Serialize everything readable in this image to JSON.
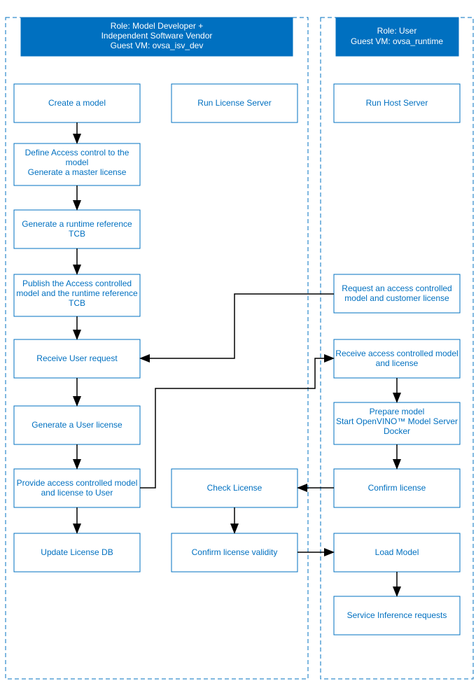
{
  "lanes": {
    "left": {
      "title1": "Role: Model Developer +",
      "title2": "Independent Software Vendor",
      "title3": "Guest VM: ovsa_isv_dev"
    },
    "right": {
      "title1": "Role: User",
      "title2": "Guest VM: ovsa_runtime"
    }
  },
  "boxes": {
    "create_model": "Create a model",
    "run_license_server": "Run License Server",
    "run_host_server": "Run Host Server",
    "access_ctrl1": "Define Access control to  the",
    "access_ctrl2": "model",
    "access_ctrl3": "Generate a master license",
    "gen_tcb1": "Generate a runtime reference",
    "gen_tcb2": "TCB",
    "publish1": "Publish the Access controlled",
    "publish2": "model and the runtime reference",
    "publish3": "TCB",
    "receive_user_req": "Receive User request",
    "gen_user_lic": "Generate a User license",
    "provide1": "Provide access controlled model",
    "provide2": "and license to User",
    "update_db": "Update License DB",
    "check_license": "Check License",
    "confirm_validity": "Confirm license validity",
    "request_ac1": "Request an access controlled",
    "request_ac2": "model and customer license",
    "receive_ac1": "Receive access controlled model",
    "receive_ac2": "and license",
    "prepare1": "Prepare model",
    "prepare2": "Start OpenVINO™ Model Server",
    "prepare3": "Docker",
    "confirm_lic": "Confirm license",
    "load_model": "Load Model",
    "service_inf": "Service Inference requests"
  }
}
